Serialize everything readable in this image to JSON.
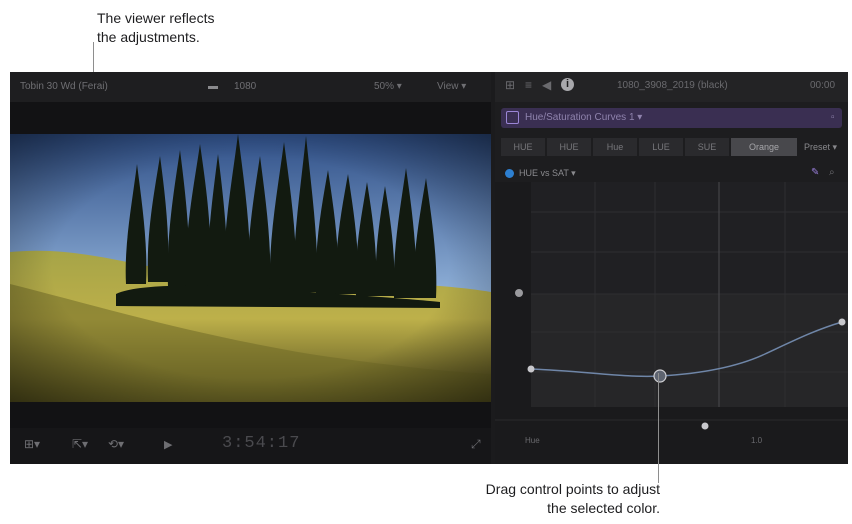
{
  "callouts": {
    "viewer": [
      "The viewer reflects",
      "the adjustments."
    ],
    "control_points": [
      "Drag control points to adjust",
      "the selected color."
    ]
  },
  "viewer": {
    "title": "Tobin 30 Wd (Ferai)",
    "clip_icon": "film-icon",
    "clip_glyph": "▬",
    "clip_name": "1080",
    "settings_label": "50% ▾",
    "view_label": "View ▾"
  },
  "viewer_controls": {
    "layout": "⊞▾",
    "tool": "⇱▾",
    "speed": "⟲▾",
    "play": "▶",
    "timecode": "3:54:17",
    "expand": "⤢"
  },
  "inspector": {
    "toolbar": {
      "grid": "⊞",
      "filter": "≡",
      "audio": "◀",
      "info": "i"
    },
    "clip_name": "1080_3908_2019 (black)",
    "duration": "00:00",
    "effect": {
      "name": "Hue/Saturation Curves 1 ▾",
      "end": "▫"
    },
    "tabs": [
      "HUE",
      "HUE",
      "Hue",
      "LUE",
      "SUE",
      "Orange"
    ],
    "active_tab": 5,
    "tabs_more": "Preset ▾",
    "curve_label": "HUE vs SAT ▾",
    "readout_left": "Hue",
    "readout_right": "1.0"
  },
  "colors": {
    "curve": "#6f86a8",
    "control_point": "#c8c8cc",
    "accent_purple": "#7a5cc7"
  }
}
